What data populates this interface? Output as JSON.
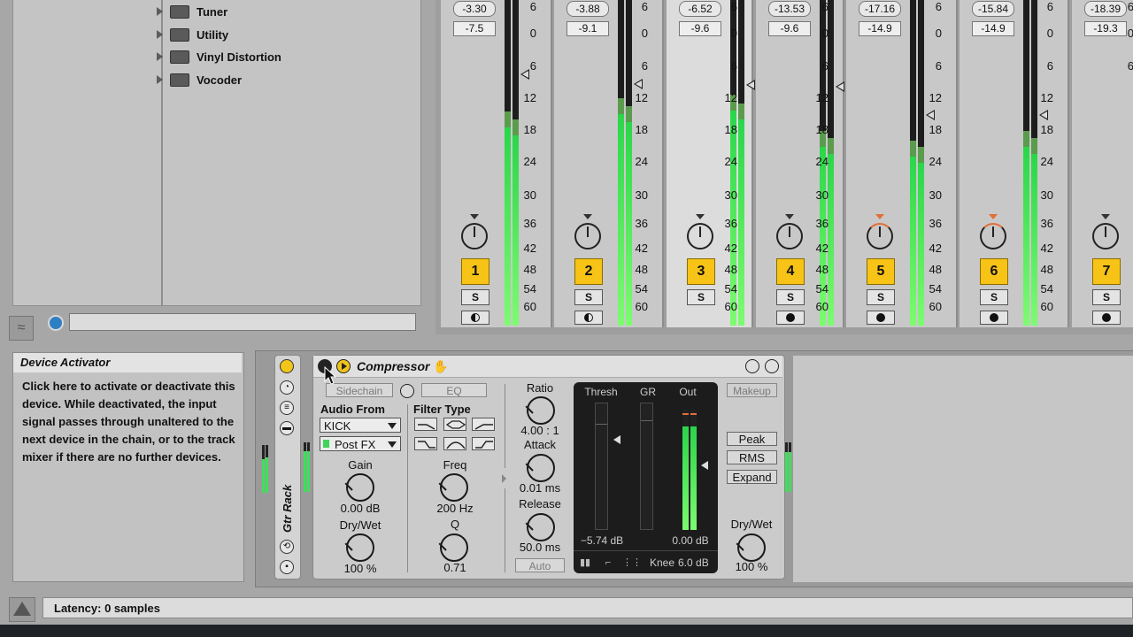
{
  "browser": {
    "items": [
      {
        "label": "Tuner"
      },
      {
        "label": "Utility"
      },
      {
        "label": "Vinyl Distortion"
      },
      {
        "label": "Vocoder"
      }
    ],
    "search_value": ""
  },
  "mixer": {
    "scale": [
      "6",
      "0",
      "6",
      "12",
      "18",
      "24",
      "30",
      "36",
      "42",
      "48",
      "54",
      "60"
    ],
    "tracks": [
      {
        "number": "1",
        "peak": "-3.30",
        "volume": "-7.5",
        "solo": "S",
        "meter_level": 0.61,
        "pan_orange": false,
        "arm": "half"
      },
      {
        "number": "2",
        "peak": "-3.88",
        "volume": "-9.1",
        "solo": "S",
        "meter_level": 0.65,
        "pan_orange": false,
        "arm": "half"
      },
      {
        "number": "3",
        "peak": "-6.52",
        "volume": "-9.6",
        "solo": "S",
        "meter_level": 0.66,
        "pan_orange": false,
        "arm": "none"
      },
      {
        "number": "4",
        "peak": "-13.53",
        "volume": "-9.6",
        "solo": "S",
        "meter_level": 0.55,
        "pan_orange": false,
        "arm": "full"
      },
      {
        "number": "5",
        "peak": "-17.16",
        "volume": "-14.9",
        "solo": "S",
        "meter_level": 0.52,
        "pan_orange": true,
        "arm": "full"
      },
      {
        "number": "6",
        "peak": "-15.84",
        "volume": "-14.9",
        "solo": "S",
        "meter_level": 0.55,
        "pan_orange": true,
        "arm": "full"
      },
      {
        "number": "7",
        "peak": "-18.39",
        "volume": "-19.3",
        "solo": "S",
        "meter_level": 0.0,
        "pan_orange": false,
        "arm": "full"
      }
    ]
  },
  "info": {
    "title": "Device Activator",
    "body": "Click here to activate or deactivate this device. While deactivated, the input signal passes through unaltered to the next device in the chain, or to the track mixer if there are no further devices."
  },
  "rack": {
    "title": "Gtr Rack"
  },
  "compressor": {
    "title": "Compressor",
    "sidechain_label": "Sidechain",
    "eq_label": "EQ",
    "audio_from_label": "Audio From",
    "audio_from_value": "KICK",
    "position_value": "Post FX",
    "filter_type_label": "Filter Type",
    "gain_label": "Gain",
    "gain_value": "0.00 dB",
    "freq_label": "Freq",
    "freq_value": "200 Hz",
    "sc_drywet_label": "Dry/Wet",
    "sc_drywet_value": "100 %",
    "q_label": "Q",
    "q_value": "0.71",
    "ratio_label": "Ratio",
    "ratio_value": "4.00 : 1",
    "attack_label": "Attack",
    "attack_value": "0.01 ms",
    "release_label": "Release",
    "release_value": "50.0 ms",
    "auto_label": "Auto",
    "thresh_label": "Thresh",
    "gr_label": "GR",
    "out_label": "Out",
    "thresh_value": "−5.74 dB",
    "out_value": "0.00 dB",
    "knee_label": "Knee",
    "knee_value": "6.0 dB",
    "makeup_label": "Makeup",
    "peak_label": "Peak",
    "rms_label": "RMS",
    "expand_label": "Expand",
    "drywet_label": "Dry/Wet",
    "drywet_value": "100 %"
  },
  "status": {
    "latency": "Latency: 0 samples"
  }
}
